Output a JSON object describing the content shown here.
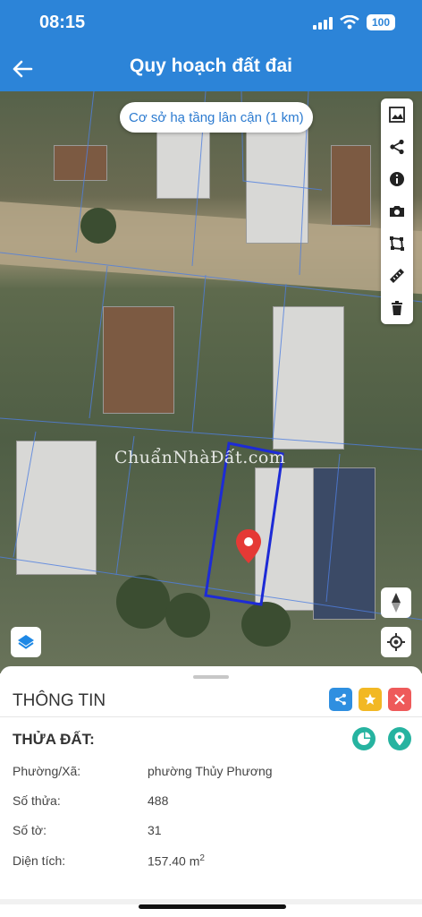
{
  "status": {
    "time": "08:15",
    "battery": "100"
  },
  "header": {
    "title": "Quy hoạch đất đai",
    "back_icon": "arrow-left-icon"
  },
  "map": {
    "nearby_chip": "Cơ sở hạ tầng lân cận (1 km)",
    "watermark": "ChuẩnNhàĐất.com",
    "tools": [
      "image-icon",
      "share-icon",
      "info-icon",
      "camera-icon",
      "polygon-icon",
      "ruler-icon",
      "trash-icon"
    ],
    "controls": [
      "compass-icon",
      "locate-icon",
      "layers-icon"
    ],
    "colors": {
      "parcel_outline": "#1d2bd6",
      "pin": "#e53935"
    }
  },
  "sheet": {
    "title": "THÔNG TIN",
    "actions": [
      "share-icon",
      "star-icon",
      "close-icon"
    ],
    "action_colors": {
      "share": "#2f8fe0",
      "star": "#f2b824",
      "close": "#ee5a5a"
    },
    "parcel_heading": "THỬA ĐẤT:",
    "round_actions": [
      "chart-icon",
      "map-pin-icon"
    ],
    "rows": [
      {
        "label": "Phường/Xã:",
        "value": "phường Thủy Phương"
      },
      {
        "label": "Số thửa:",
        "value": "488"
      },
      {
        "label": "Số tờ:",
        "value": "31"
      },
      {
        "label": "Diện tích:",
        "value": "157.40 m",
        "sup": "2"
      }
    ]
  }
}
